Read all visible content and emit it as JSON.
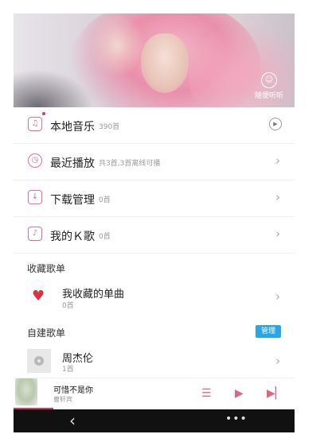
{
  "header": {
    "surprise_label": "随便听听"
  },
  "menu": [
    {
      "title": "本地音乐",
      "sub": "390首",
      "trail": "play"
    },
    {
      "title": "最近播放",
      "sub": "共3首,3首离线可播",
      "trail": "chevron"
    },
    {
      "title": "下载管理",
      "sub": "0首",
      "trail": "chevron"
    },
    {
      "title": "我的Ｋ歌",
      "sub": "0首",
      "trail": "chevron"
    }
  ],
  "favorites": {
    "section_title": "收藏歌单",
    "title": "我收藏的单曲",
    "count": "0首"
  },
  "custom": {
    "section_title": "自建歌单",
    "manage_label": "管理",
    "playlist_title": "周杰伦",
    "playlist_count": "1首"
  },
  "now_playing": {
    "song": "可惜不是你",
    "artist": "曹轩宾"
  },
  "colors": {
    "accent": "#e0375b",
    "manage_bg": "#2aa5e8"
  }
}
